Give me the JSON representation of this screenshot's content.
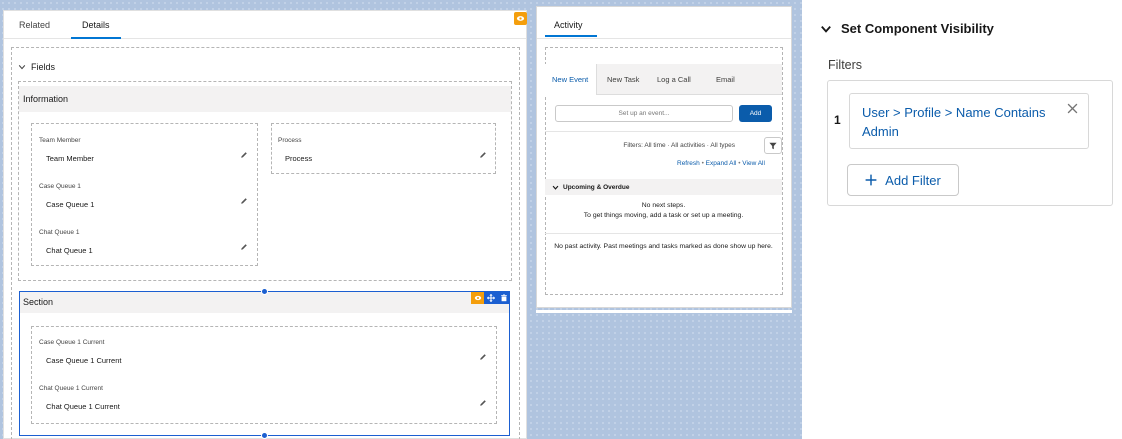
{
  "details_card": {
    "tabs": [
      {
        "label": "Related",
        "active": false
      },
      {
        "label": "Details",
        "active": true
      }
    ],
    "fields_label": "Fields",
    "information_section": {
      "title": "Information",
      "left_fields": [
        {
          "label": "Team Member",
          "value": "Team Member"
        },
        {
          "label": "Case Queue 1",
          "value": "Case Queue 1"
        },
        {
          "label": "Chat Queue 1",
          "value": "Chat Queue 1"
        }
      ],
      "right_fields": [
        {
          "label": "Process",
          "value": "Process"
        }
      ]
    },
    "section": {
      "title": "Section",
      "fields": [
        {
          "label": "Case Queue 1 Current",
          "value": "Case Queue 1 Current"
        },
        {
          "label": "Chat Queue 1 Current",
          "value": "Chat Queue 1 Current"
        }
      ]
    }
  },
  "activity_card": {
    "tab": "Activity",
    "publisher_tabs": [
      "New Event",
      "New Task",
      "Log a Call",
      "Email"
    ],
    "event_placeholder": "Set up an event...",
    "add_label": "Add",
    "filters_text": "Filters: All time · All activities · All types",
    "links": {
      "refresh": "Refresh",
      "expand_all": "Expand All",
      "view_all": "View All",
      "separator": "•"
    },
    "upcoming_label": "Upcoming & Overdue",
    "no_steps_line1": "No next steps.",
    "no_steps_line2": "To get things moving, add a task or set up a meeting.",
    "no_past_activity": "No past activity. Past meetings and tasks marked as done show up here."
  },
  "visibility_panel": {
    "title": "Set Component Visibility",
    "filters_label": "Filters",
    "filters": [
      {
        "number": "1",
        "text": "User > Profile > Name Contains Admin"
      }
    ],
    "add_filter_label": "Add Filter"
  },
  "colors": {
    "brand_blue": "#0176d3",
    "link_blue": "#0b5cab",
    "selection_blue": "#1b5fd1",
    "badge_orange": "#f49e0c",
    "canvas_blue": "#b0c4df"
  }
}
